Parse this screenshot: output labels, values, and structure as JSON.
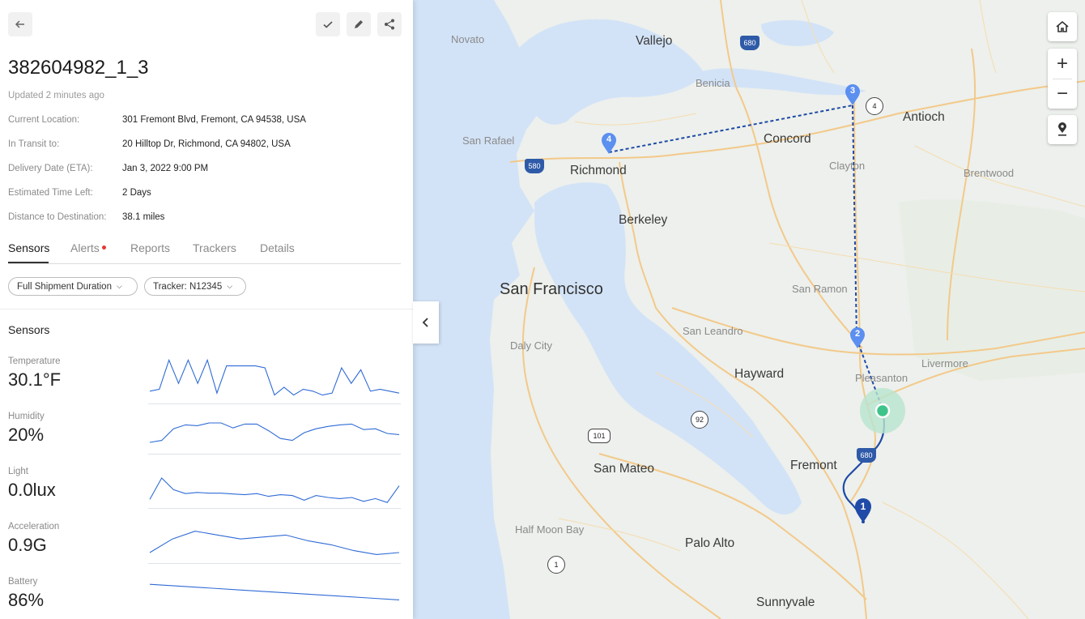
{
  "header": {
    "back_icon": "arrow-left-icon",
    "actions": [
      "check-icon",
      "pencil-icon",
      "share-icon"
    ]
  },
  "shipment": {
    "title": "382604982_1_3",
    "updated": "Updated 2 minutes ago",
    "details": [
      {
        "label": "Current Location:",
        "value": "301 Fremont Blvd, Fremont, CA 94538, USA"
      },
      {
        "label": "In Transit to:",
        "value": "20 Hilltop Dr, Richmond, CA 94802, USA"
      },
      {
        "label": "Delivery Date (ETA):",
        "value": "Jan 3, 2022 9:00 PM"
      },
      {
        "label": "Estimated Time Left:",
        "value": "2 Days"
      },
      {
        "label": "Distance to Destination:",
        "value": "38.1 miles"
      }
    ]
  },
  "tabs": [
    "Sensors",
    "Alerts",
    "Reports",
    "Trackers",
    "Details"
  ],
  "active_tab": "Sensors",
  "filters": {
    "duration": "Full Shipment Duration",
    "tracker": "Tracker: N12345"
  },
  "sensors": {
    "heading": "Sensors",
    "items": [
      {
        "label": "Temperature",
        "value": "30.1°F",
        "series": [
          0.15,
          0.2,
          0.95,
          0.35,
          0.95,
          0.35,
          0.95,
          0.1,
          0.8,
          0.8,
          0.8,
          0.8,
          0.75,
          0.05,
          0.25,
          0.05,
          0.2,
          0.15,
          0.05,
          0.1,
          0.75,
          0.35,
          0.7,
          0.15,
          0.2,
          0.15,
          0.1
        ]
      },
      {
        "label": "Humidity",
        "value": "20%",
        "series": [
          0.25,
          0.3,
          0.6,
          0.7,
          0.68,
          0.75,
          0.75,
          0.62,
          0.72,
          0.72,
          0.55,
          0.35,
          0.3,
          0.5,
          0.6,
          0.66,
          0.7,
          0.72,
          0.58,
          0.6,
          0.48,
          0.45
        ]
      },
      {
        "label": "Light",
        "value": "0.0lux",
        "series": [
          0.2,
          0.75,
          0.45,
          0.35,
          0.38,
          0.36,
          0.36,
          0.34,
          0.32,
          0.35,
          0.28,
          0.32,
          0.3,
          0.18,
          0.3,
          0.25,
          0.22,
          0.25,
          0.15,
          0.22,
          0.12,
          0.55
        ]
      },
      {
        "label": "Acceleration",
        "value": "0.9G",
        "series": [
          0.25,
          0.6,
          0.8,
          0.7,
          0.6,
          0.65,
          0.7,
          0.55,
          0.45,
          0.3,
          0.2,
          0.25
        ]
      },
      {
        "label": "Battery",
        "value": "86%",
        "series": [
          0.85,
          0.8,
          0.75,
          0.7,
          0.65,
          0.6,
          0.55,
          0.5,
          0.45
        ]
      }
    ]
  },
  "map": {
    "cities": [
      "Novato",
      "Vallejo",
      "Benicia",
      "Antioch",
      "San Rafael",
      "Concord",
      "Richmond",
      "Clayton",
      "Brentwood",
      "Berkeley",
      "San Francisco",
      "San Ramon",
      "San Leandro",
      "Daly City",
      "Hayward",
      "Pleasanton",
      "Livermore",
      "San Mateo",
      "Fremont",
      "Half Moon Bay",
      "Palo Alto",
      "Sunnyvale"
    ],
    "shields": [
      "680",
      "580",
      "680",
      "101",
      "92",
      "4",
      "1"
    ],
    "markers": [
      "1",
      "2",
      "3",
      "4"
    ],
    "controls": [
      "home-icon",
      "zoom-in-icon",
      "zoom-out-icon",
      "location-pin-icon"
    ],
    "zoom_in": "+",
    "zoom_out": "−",
    "route_color": "#1f4aa8",
    "marker_color": "#5b8ff0",
    "current_color": "#3ec48a"
  }
}
